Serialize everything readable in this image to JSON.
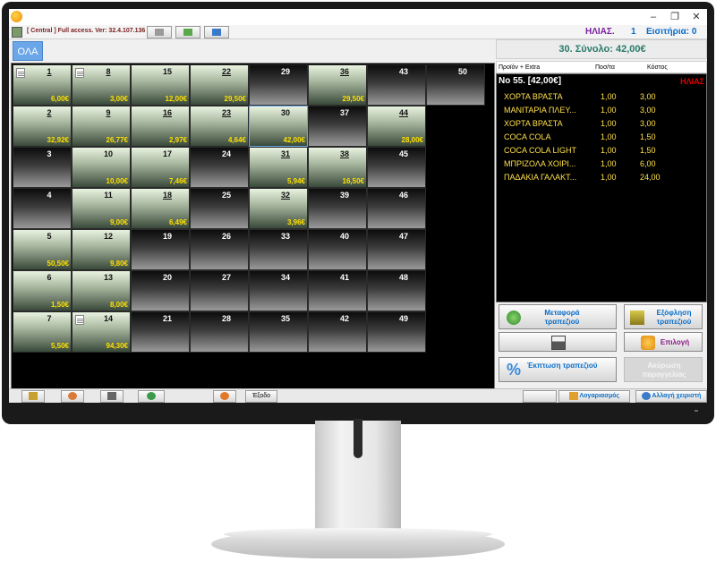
{
  "header": {
    "access_text": "[ Central ] Full access. Ver: 32.4.107.136",
    "user": "ΗΛΙΑΣ.",
    "user_number": "1",
    "income_label": "Εισιτήρια: 0"
  },
  "window": {
    "minimize": "–",
    "maximize": "❐",
    "close": "✕"
  },
  "category": {
    "label": "ΟΛΑ"
  },
  "tables": [
    {
      "num": "1",
      "amount": "6,00€",
      "occ": true,
      "note": true,
      "u": true
    },
    {
      "num": "8",
      "amount": "3,00€",
      "occ": true,
      "note": true,
      "u": true
    },
    {
      "num": "15",
      "amount": "12,00€",
      "occ": true,
      "note": false,
      "u": false
    },
    {
      "num": "22",
      "amount": "29,50€",
      "occ": true,
      "note": false,
      "u": true
    },
    {
      "num": "29",
      "amount": "",
      "occ": false,
      "note": false,
      "u": false
    },
    {
      "num": "36",
      "amount": "29,50€",
      "occ": true,
      "note": false,
      "u": true
    },
    {
      "num": "43",
      "amount": "",
      "occ": false,
      "note": false,
      "u": false
    },
    {
      "num": "50",
      "amount": "",
      "occ": false,
      "note": false,
      "u": false
    },
    {
      "num": "2",
      "amount": "32,92€",
      "occ": true,
      "note": false,
      "u": true
    },
    {
      "num": "9",
      "amount": "26,77€",
      "occ": true,
      "note": false,
      "u": true
    },
    {
      "num": "16",
      "amount": "2,97€",
      "occ": true,
      "note": false,
      "u": true
    },
    {
      "num": "23",
      "amount": "4,64€",
      "occ": true,
      "note": false,
      "u": true
    },
    {
      "num": "30",
      "amount": "42,00€",
      "occ": true,
      "note": false,
      "u": false,
      "sel": true
    },
    {
      "num": "37",
      "amount": "",
      "occ": false,
      "note": false,
      "u": false
    },
    {
      "num": "44",
      "amount": "28,00€",
      "occ": true,
      "note": false,
      "u": true
    },
    {
      "num": "3",
      "amount": "",
      "occ": false,
      "note": false,
      "u": false
    },
    {
      "num": "10",
      "amount": "10,00€",
      "occ": true,
      "note": false,
      "u": false
    },
    {
      "num": "17",
      "amount": "7,46€",
      "occ": true,
      "note": false,
      "u": false
    },
    {
      "num": "24",
      "amount": "",
      "occ": false,
      "note": false,
      "u": false
    },
    {
      "num": "31",
      "amount": "5,94€",
      "occ": true,
      "note": false,
      "u": true
    },
    {
      "num": "38",
      "amount": "16,50€",
      "occ": true,
      "note": false,
      "u": true
    },
    {
      "num": "45",
      "amount": "",
      "occ": false,
      "note": false,
      "u": false
    },
    {
      "num": "4",
      "amount": "",
      "occ": false,
      "note": false,
      "u": false
    },
    {
      "num": "11",
      "amount": "9,00€",
      "occ": true,
      "note": false,
      "u": false
    },
    {
      "num": "18",
      "amount": "6,49€",
      "occ": true,
      "note": false,
      "u": true
    },
    {
      "num": "25",
      "amount": "",
      "occ": false,
      "note": false,
      "u": false
    },
    {
      "num": "32",
      "amount": "3,96€",
      "occ": true,
      "note": false,
      "u": true
    },
    {
      "num": "39",
      "amount": "",
      "occ": false,
      "note": false,
      "u": false
    },
    {
      "num": "46",
      "amount": "",
      "occ": false,
      "note": false,
      "u": false
    },
    {
      "num": "5",
      "amount": "50,50€",
      "occ": true,
      "note": false,
      "u": false
    },
    {
      "num": "12",
      "amount": "9,80€",
      "occ": true,
      "note": false,
      "u": false
    },
    {
      "num": "19",
      "amount": "",
      "occ": false,
      "note": false,
      "u": false
    },
    {
      "num": "26",
      "amount": "",
      "occ": false,
      "note": false,
      "u": false
    },
    {
      "num": "33",
      "amount": "",
      "occ": false,
      "note": false,
      "u": false
    },
    {
      "num": "40",
      "amount": "",
      "occ": false,
      "note": false,
      "u": false
    },
    {
      "num": "47",
      "amount": "",
      "occ": false,
      "note": false,
      "u": false
    },
    {
      "num": "6",
      "amount": "1,50€",
      "occ": true,
      "note": false,
      "u": false
    },
    {
      "num": "13",
      "amount": "8,00€",
      "occ": true,
      "note": false,
      "u": false
    },
    {
      "num": "20",
      "amount": "",
      "occ": false,
      "note": false,
      "u": false
    },
    {
      "num": "27",
      "amount": "",
      "occ": false,
      "note": false,
      "u": false
    },
    {
      "num": "34",
      "amount": "",
      "occ": false,
      "note": false,
      "u": false
    },
    {
      "num": "41",
      "amount": "",
      "occ": false,
      "note": false,
      "u": false
    },
    {
      "num": "48",
      "amount": "",
      "occ": false,
      "note": false,
      "u": false
    },
    {
      "num": "7",
      "amount": "5,50€",
      "occ": true,
      "note": false,
      "u": false
    },
    {
      "num": "14",
      "amount": "94,30€",
      "occ": true,
      "note": true,
      "u": false
    },
    {
      "num": "21",
      "amount": "",
      "occ": false,
      "note": false,
      "u": false
    },
    {
      "num": "28",
      "amount": "",
      "occ": false,
      "note": false,
      "u": false
    },
    {
      "num": "35",
      "amount": "",
      "occ": false,
      "note": false,
      "u": false
    },
    {
      "num": "42",
      "amount": "",
      "occ": false,
      "note": false,
      "u": false
    },
    {
      "num": "49",
      "amount": "",
      "occ": false,
      "note": false,
      "u": false
    }
  ],
  "total": "30. Σύνολο: 42,00€",
  "order_header": {
    "product": "Προϊόν + Extra",
    "qty": "Ποσ/τα",
    "cost": "Κόστος"
  },
  "order": {
    "title": "No 55. [42,00€]",
    "waiter": "ΗΛΙΑΣ",
    "items": [
      {
        "name": "ΧΟΡΤΑ ΒΡΑΣΤΑ",
        "qty": "1,00",
        "price": "3,00"
      },
      {
        "name": "ΜΑΝΙΤΑΡΙΑ ΠΛΕΥ...",
        "qty": "1,00",
        "price": "3,00"
      },
      {
        "name": "ΧΟΡΤΑ ΒΡΑΣΤΑ",
        "qty": "1,00",
        "price": "3,00"
      },
      {
        "name": "COCA COLA",
        "qty": "1,00",
        "price": "1,50"
      },
      {
        "name": "COCA COLA LIGHT",
        "qty": "1,00",
        "price": "1,50"
      },
      {
        "name": "ΜΠΡΙΖΟΛΑ ΧΟΙΡΙ...",
        "qty": "1,00",
        "price": "6,00"
      },
      {
        "name": "ΠΑΔΑΚΙΑ ΓΑΛΑΚΤ...",
        "qty": "1,00",
        "price": "24,00"
      }
    ]
  },
  "actions": {
    "transfer": "Μεταφορά τραπεζιού",
    "settle": "Εξόφληση τραπεζιού",
    "select": "Επιλογή",
    "discount": "Έκπτωση τραπεζιού",
    "cancel": "Ακύρωση παραγγελίας"
  },
  "bottom": {
    "exit": "Έξοδο",
    "account": "Λογαριασμός",
    "change_operator": "Αλλαγή χειριστή"
  }
}
